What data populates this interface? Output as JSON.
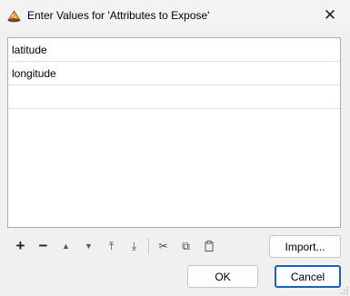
{
  "window": {
    "title": "Enter Values for 'Attributes to Expose'",
    "close_glyph": "✕",
    "app_icon": "fme-wizard-hat-icon"
  },
  "list": {
    "rows": [
      "latitude",
      "longitude",
      ""
    ]
  },
  "toolbar": {
    "add_glyph": "+",
    "remove_glyph": "−",
    "move_up_glyph": "▲",
    "move_down_glyph": "▼",
    "move_top_glyph": "⤒",
    "move_bottom_glyph": "⤓",
    "cut_glyph": "✂",
    "copy_glyph": "⧉",
    "paste_glyph": "📋"
  },
  "buttons": {
    "import_label": "Import...",
    "ok_label": "OK",
    "cancel_label": "Cancel"
  },
  "colors": {
    "focus_border": "#1f5fb8",
    "list_background": "#ffffff",
    "dialog_background": "#f0f0f0"
  }
}
